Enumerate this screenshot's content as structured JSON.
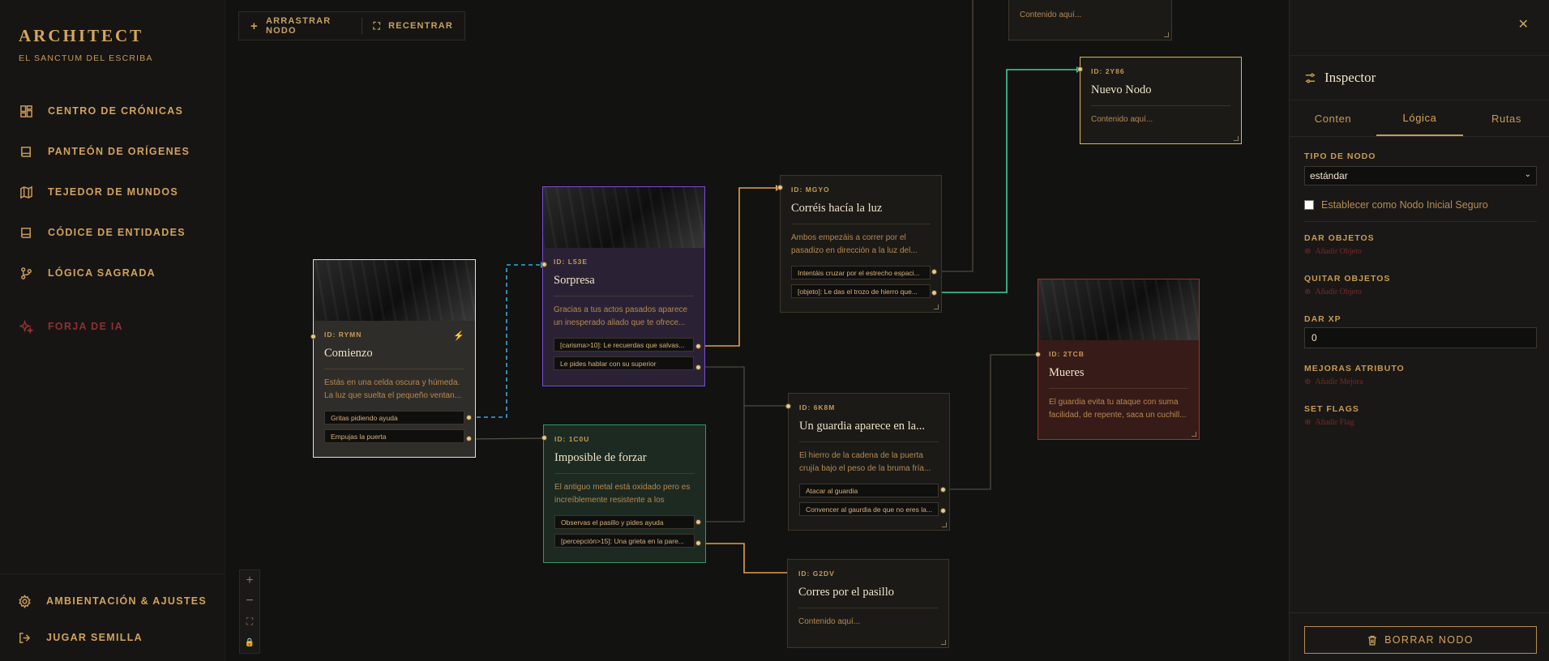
{
  "sidebar": {
    "brand": "ARCHITECT",
    "subtitle": "EL SANCTUM DEL ESCRIBA",
    "items": [
      {
        "label": "CENTRO DE CRÓNICAS",
        "icon": "dashboard-icon"
      },
      {
        "label": "PANTEÓN DE ORÍGENES",
        "icon": "book-icon"
      },
      {
        "label": "TEJEDOR DE MUNDOS",
        "icon": "map-icon"
      },
      {
        "label": "CÓDICE DE ENTIDADES",
        "icon": "book-icon"
      },
      {
        "label": "LÓGICA SAGRADA",
        "icon": "branch-icon"
      }
    ],
    "forge": {
      "label": "FORJA DE IA",
      "icon": "sparkle-icon"
    },
    "bottom": [
      {
        "label": "AMBIENTACIÓN & AJUSTES",
        "icon": "gear-icon"
      },
      {
        "label": "JUGAR SEMILLA",
        "icon": "exit-icon"
      }
    ]
  },
  "toolbar": {
    "drag_label": "ARRASTRAR NODO",
    "recenter_label": "RECENTRAR"
  },
  "zoom": {
    "in": "+",
    "out": "−",
    "fit": "⛶",
    "lock": "🔒"
  },
  "nodes": {
    "top_stub": {
      "text": "Contenido aquí..."
    },
    "rymn": {
      "id": "ID: RYMN",
      "title": "Comienzo",
      "text": "Estás en una celda oscura y húmeda. La luz que suelta el pequeño ventan...",
      "options": [
        "Gritas pidiendo ayuda",
        "Empujas la puerta"
      ]
    },
    "l53e": {
      "id": "ID: L53E",
      "title": "Sorpresa",
      "text": "Gracias a tus actos pasados aparece un inesperado aliado que te ofrece...",
      "options": [
        "[carisma>10]: Le recuerdas que salvas...",
        "Le pides hablar con su superior"
      ]
    },
    "c1ou": {
      "id": "ID: 1C0U",
      "title": "Imposible de forzar",
      "text": "El antiguo metal está oxidado pero es increíblemente resistente a los golpes...",
      "options": [
        "Observas el pasillo y pides ayuda",
        "[percepción>15]: Una grieta en la pare..."
      ]
    },
    "mgyo": {
      "id": "ID: MGYO",
      "title": "Corréis hacía la luz",
      "text": "Ambos empezáis a correr por el pasadizo en dirección a la luz del...",
      "options": [
        "Intentáis cruzar por el estrecho espaci...",
        "[objeto]: Le das el trozo de hierro que..."
      ]
    },
    "2y86": {
      "id": "ID: 2Y86",
      "title": "Nuevo Nodo",
      "text": "Contenido aquí..."
    },
    "6k8m": {
      "id": "ID: 6K8M",
      "title": "Un guardia aparece en la...",
      "text": "El hierro de la cadena de la puerta crujía bajo el peso de la bruma fría...",
      "options": [
        "Atacar al guardia",
        "Convencer al gaurdia de que no eres la..."
      ]
    },
    "2tcb": {
      "id": "ID: 2TCB",
      "title": "Mueres",
      "text": "El guardia evita tu ataque con suma facilidad, de repente, saca un cuchill..."
    },
    "g2dv": {
      "id": "ID: G2DV",
      "title": "Corres por el pasillo",
      "text": "Contenido aquí..."
    }
  },
  "inspector": {
    "title": "Inspector",
    "close": "✕",
    "tabs": [
      "Conten",
      "Lógica",
      "Rutas"
    ],
    "active_tab": "Lógica",
    "node_type_label": "TIPO DE NODO",
    "node_type_value": "estándar",
    "safe_start_label": "Establecer como Nodo Inicial Seguro",
    "give_items_label": "DAR OBJETOS",
    "give_items_add": "Añadir Objeto",
    "remove_items_label": "QUITAR OBJETOS",
    "remove_items_add": "Añadir Objeto",
    "xp_label": "DAR XP",
    "xp_value": "0",
    "attr_label": "MEJORAS ATRIBUTO",
    "attr_add": "Añadir Mejora",
    "flags_label": "SET FLAGS",
    "flags_add": "Añadir Flag",
    "delete_label": "BORRAR NODO"
  },
  "colors": {
    "accent": "#c99a53",
    "purple": "#7b4bd6",
    "green": "#2e9a6a",
    "red": "#a8302a",
    "gold": "#d9b45a",
    "teal": "#3bd39b",
    "cyan": "#3aa8d8",
    "orange": "#e0a050"
  }
}
